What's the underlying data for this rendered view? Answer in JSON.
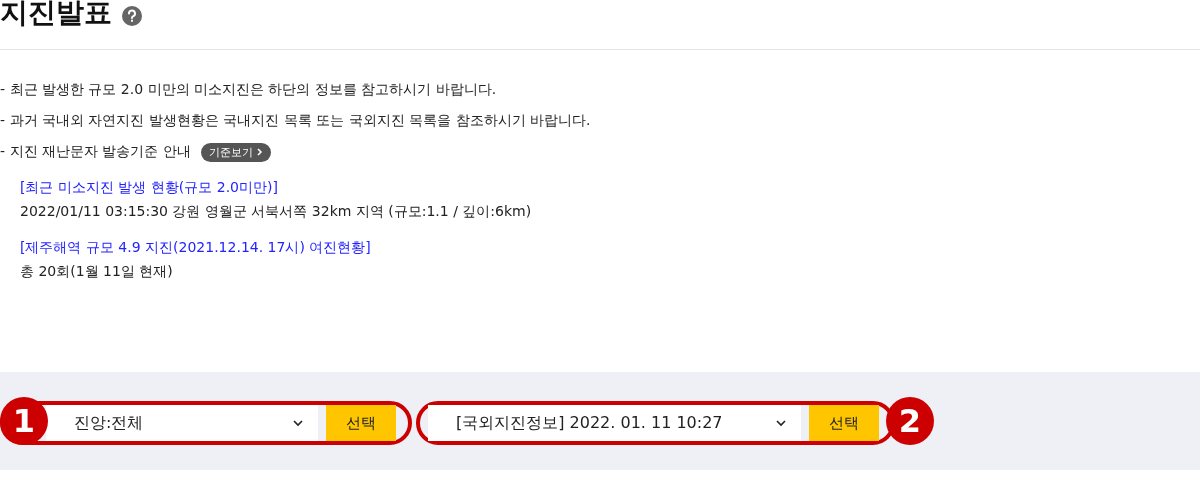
{
  "title": "지진발표",
  "notices": [
    {
      "text": "- 최근 발생한 규모 2.0 미만의 미소지진은 하단의 정보를 참고하시기 바랍니다."
    },
    {
      "text": "- 과거 국내외 자연지진 발생현황은 국내지진 목록 또는 국외지진 목록을 참조하시기 바랍니다."
    },
    {
      "text": "- 지진 재난문자 발송기준 안내",
      "button": "기준보기"
    }
  ],
  "reports": [
    {
      "link": "[최근 미소지진 발생 현황(규모 2.0미만)]",
      "detail": "2022/01/11 03:15:30 강원 영월군 서북서쪽 32km 지역 (규모:1.1 / 깊이:6km)"
    },
    {
      "link": "[제주해역 규모 4.9 지진(2021.12.14. 17시) 여진현황]",
      "detail": "총 20회(1월 11일 현재)"
    }
  ],
  "selectors": [
    {
      "badge": "1",
      "value": "진앙:전체",
      "button": "선택"
    },
    {
      "badge": "2",
      "value": "[국외지진정보] 2022. 01. 11 10:27",
      "button": "선택"
    }
  ]
}
